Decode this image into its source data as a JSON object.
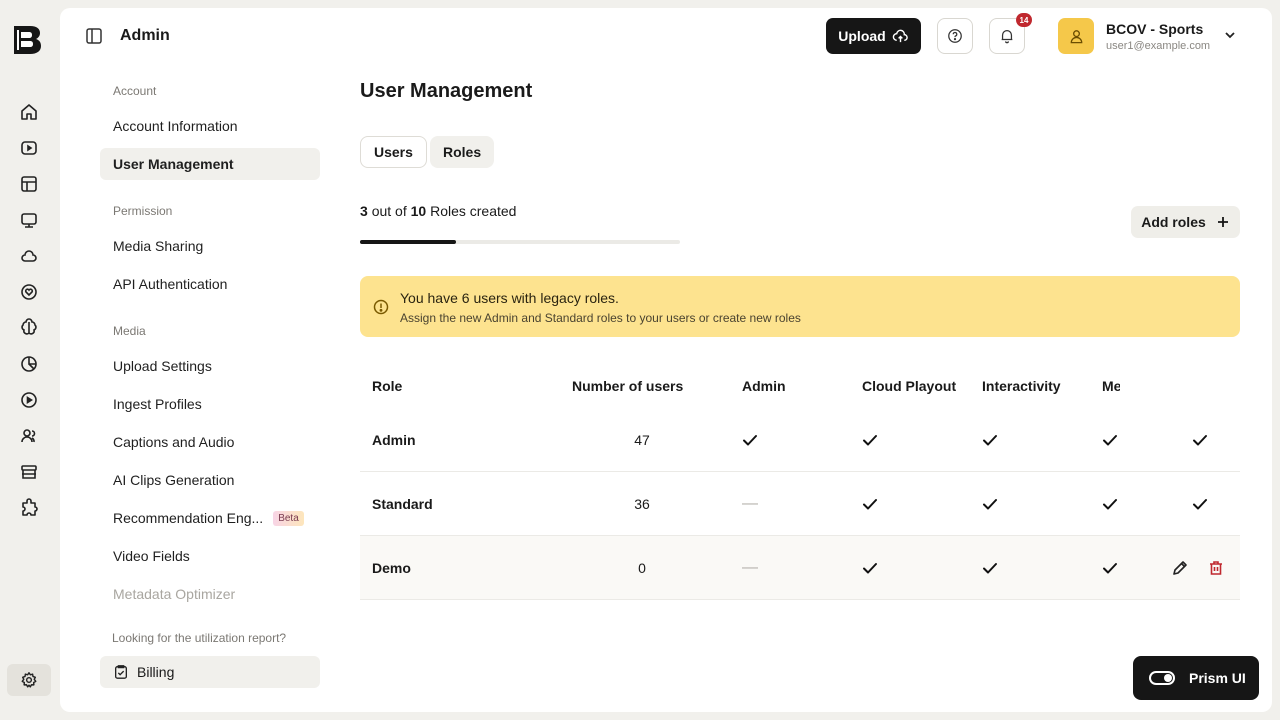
{
  "app": {
    "title": "Admin"
  },
  "header": {
    "upload_label": "Upload",
    "notification_count": "14",
    "account_name": "BCOV - Sports",
    "account_email": "user1@example.com"
  },
  "rail_icons": [
    "home-icon",
    "video-icon",
    "layout-icon",
    "monitor-icon",
    "cloud-icon",
    "heart-badge-icon",
    "brain-icon",
    "pie-chart-icon",
    "play-circle-icon",
    "users-icon",
    "archive-icon",
    "puzzle-icon",
    "gear-icon"
  ],
  "settings_nav": {
    "account_heading": "Account",
    "account_information": "Account Information",
    "user_management": "User Management",
    "permission_heading": "Permission",
    "media_sharing": "Media Sharing",
    "api_authentication": "API Authentication",
    "media_heading": "Media",
    "upload_settings": "Upload Settings",
    "ingest_profiles": "Ingest Profiles",
    "captions_audio": "Captions and Audio",
    "ai_clips": "AI Clips Generation",
    "recommendation_engine": "Recommendation Eng...",
    "beta_badge": "Beta",
    "video_fields": "Video Fields",
    "metadata_optimizer": "Metadata Optimizer",
    "utilization_text": "Looking for the utilization report?",
    "billing": "Billing"
  },
  "main": {
    "title": "User Management",
    "tabs": {
      "users": "Users",
      "roles": "Roles"
    },
    "roles_used": "3",
    "roles_out_of": "out of",
    "roles_total": "10",
    "roles_suffix": "Roles created",
    "roles_progress": 0.3,
    "add_roles_label": "Add roles",
    "alert": {
      "title": "You have 6 users with legacy roles.",
      "subtitle": "Assign the new Admin and Standard roles to your users or create new roles"
    }
  },
  "table": {
    "headers": {
      "role": "Role",
      "users": "Number of users",
      "admin": "Admin",
      "cloud_playout": "Cloud Playout",
      "interactivity": "Interactivity",
      "truncated": "Me"
    },
    "rows": [
      {
        "name": "Admin",
        "count": "47",
        "admin": true,
        "cloud_playout": true,
        "interactivity": true,
        "col_me": true,
        "extra": true
      },
      {
        "name": "Standard",
        "count": "36",
        "admin": false,
        "cloud_playout": true,
        "interactivity": true,
        "col_me": true,
        "extra": true
      },
      {
        "name": "Demo",
        "count": "0",
        "admin": false,
        "cloud_playout": true,
        "interactivity": true,
        "col_me": true,
        "extra": false
      }
    ],
    "dash": "—"
  },
  "prism": {
    "label": "Prism UI"
  }
}
